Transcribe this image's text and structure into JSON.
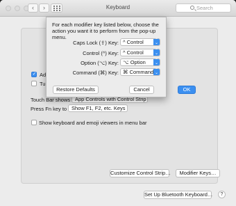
{
  "window": {
    "title": "Keyboard"
  },
  "toolbar": {
    "back_glyph": "‹",
    "forward_glyph": "›",
    "search_placeholder": "Search"
  },
  "main": {
    "adjust_prefix": "Adj",
    "turn_prefix": "Tur",
    "touch_bar_label": "Touch Bar shows",
    "touch_bar_value": "App Controls with Control Strip",
    "press_fn_label": "Press Fn key to",
    "press_fn_value": "Show F1, F2, etc. Keys",
    "viewers_label": "Show keyboard and emoji viewers in menu bar",
    "customize_button": "Customize Control Strip…",
    "modifier_button": "Modifier Keys…",
    "bluetooth_button": "Set Up Bluetooth Keyboard…",
    "help_glyph": "?"
  },
  "sheet": {
    "instructions": "For each modifier key listed below, choose the action you want it to perform from the pop-up menu.",
    "rows": [
      {
        "label": "Caps Lock (⇪) Key:",
        "value": "^ Control"
      },
      {
        "label": "Control (^) Key:",
        "value": "^ Control"
      },
      {
        "label": "Option (⌥) Key:",
        "value": "⌥ Option"
      },
      {
        "label": "Command (⌘) Key:",
        "value": "⌘ Command"
      }
    ],
    "restore_button": "Restore Defaults",
    "cancel_button": "Cancel",
    "ok_button": "OK"
  },
  "colors": {
    "accent": "#3b8ff0",
    "window_bg": "#ececec",
    "desktop": "#1e1e1e"
  },
  "icons": {
    "stepper": "up-down-chevrons-icon",
    "search": "search-icon",
    "grid": "show-all-grid-icon"
  }
}
